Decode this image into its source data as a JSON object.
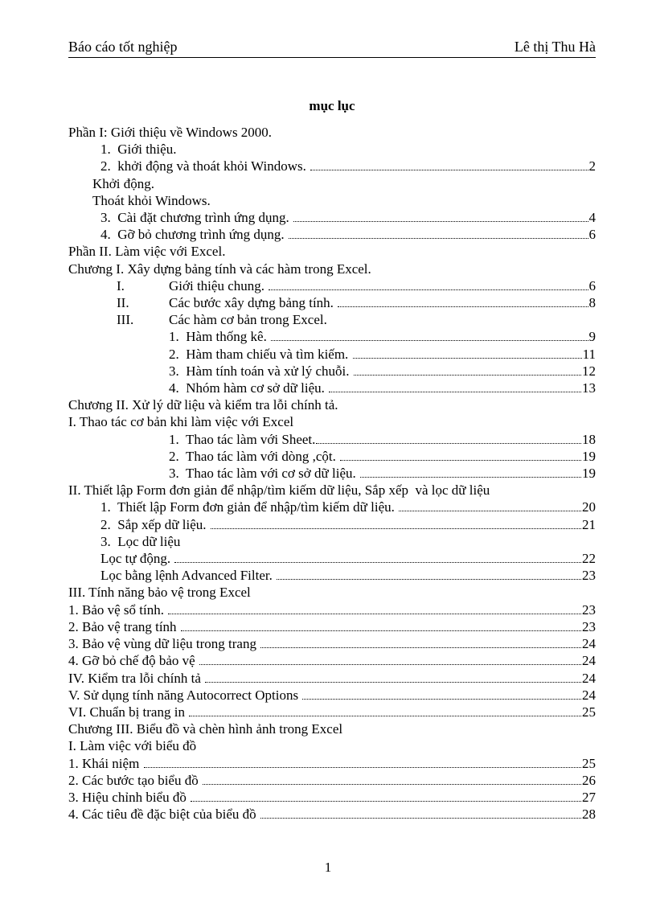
{
  "header": {
    "left": "Báo cáo tốt nghiệp",
    "right": "Lê thị Thu Hà"
  },
  "title": "mục lục",
  "footer_page": "1",
  "lines": [
    {
      "indent": "indent-0",
      "text": "Phần I: Giới thiệu về Windows 2000."
    },
    {
      "indent": "indent-1b",
      "text": "1.  Giới thiệu."
    },
    {
      "indent": "indent-1b",
      "text": "2.  khởi động và thoát khỏi Windows. ",
      "page": "2"
    },
    {
      "indent": "indent-1",
      "text": "Khởi động."
    },
    {
      "indent": "indent-1",
      "text": "Thoát khỏi Windows."
    },
    {
      "indent": "indent-1b",
      "text": "3.  Cài đặt chương trình ứng dụng. ",
      "page": "4"
    },
    {
      "indent": "indent-1b",
      "text": "4.  Gỡ bỏ chương trình ứng dụng. ",
      "page": "6"
    },
    {
      "indent": "indent-0",
      "text": "Phần II. Làm việc với Excel."
    },
    {
      "indent": "indent-0",
      "text": "Chương I. Xây dựng bảng tính và các hàm trong Excel."
    },
    {
      "indent": "indent-r",
      "roman": "I.",
      "text": "Giới thiệu chung. ",
      "page": "6"
    },
    {
      "indent": "indent-r",
      "roman": "II.",
      "text": "Các bước xây dựng bảng tính. ",
      "page": "8"
    },
    {
      "indent": "indent-r",
      "roman": "III.",
      "text": "Các hàm cơ bản trong Excel."
    },
    {
      "indent": "indent-sub3",
      "text": "1.  Hàm thống kê. ",
      "page": "9"
    },
    {
      "indent": "indent-sub3",
      "text": "2.  Hàm tham chiếu và tìm kiếm. ",
      "page": "11"
    },
    {
      "indent": "indent-sub3",
      "text": "3.  Hàm tính toán và xử lý chuỗi. ",
      "page": "12"
    },
    {
      "indent": "indent-sub3",
      "text": "4.  Nhóm hàm cơ sở dữ liệu. ",
      "page": "13"
    },
    {
      "indent": "indent-0",
      "text": "Chương II. Xử lý dữ liệu và kiểm tra lỗi chính tả."
    },
    {
      "indent": "indent-0",
      "text": "I. Thao tác cơ bản khi làm việc với Excel"
    },
    {
      "indent": "indent-sub3",
      "text": "1.  Thao tác làm với Sheet.",
      "page": "18"
    },
    {
      "indent": "indent-sub3",
      "text": "2.  Thao tác làm với dòng ,cột. ",
      "page": "19"
    },
    {
      "indent": "indent-sub3",
      "text": "3.  Thao tác làm với cơ sở dữ liệu. ",
      "page": "19"
    },
    {
      "indent": "indent-0",
      "text": "II. Thiết lập Form đơn giản để nhập/tìm kiếm dữ liệu, Sắp xếp  và lọc dữ liệu"
    },
    {
      "indent": "indent-1b",
      "text": "1.  Thiết lập Form đơn giản để nhập/tìm kiếm dữ liệu. ",
      "page": "20"
    },
    {
      "indent": "indent-1b",
      "text": "2.  Sắp xếp dữ liệu. ",
      "page": "21"
    },
    {
      "indent": "indent-1b",
      "text": "3.  Lọc dữ liệu"
    },
    {
      "indent": "indent-1b",
      "text": "Lọc tự động. ",
      "page": "22"
    },
    {
      "indent": "indent-1b",
      "text": "Lọc bằng lệnh Advanced Filter. ",
      "page": "23"
    },
    {
      "indent": "indent-0",
      "text": "III. Tính năng bảo vệ trong Excel"
    },
    {
      "indent": "indent-0",
      "text": "1. Bảo vệ sổ tính. ",
      "page": "23"
    },
    {
      "indent": "indent-0",
      "text": "2. Bảo vệ trang tính ",
      "page": "23"
    },
    {
      "indent": "indent-0",
      "text": "3. Bảo vệ vùng dữ liệu trong trang ",
      "page": "24"
    },
    {
      "indent": "indent-0",
      "text": "4. Gỡ bỏ chế độ bảo vệ ",
      "page": "24"
    },
    {
      "indent": "indent-0",
      "text": "IV. Kiểm tra lỗi chính tả ",
      "page": "24"
    },
    {
      "indent": "indent-0",
      "text": "V. Sử dụng tính năng Autocorrect Options ",
      "page": "24"
    },
    {
      "indent": "indent-0",
      "text": "VI. Chuẩn bị trang in ",
      "page": "25"
    },
    {
      "indent": "indent-0",
      "text": "Chương III. Biểu đồ và chèn hình ảnh trong Excel"
    },
    {
      "indent": "indent-0",
      "text": "I. Làm việc với biểu đồ"
    },
    {
      "indent": "indent-0",
      "text": "1. Khái niệm ",
      "page": "25"
    },
    {
      "indent": "indent-0",
      "text": "2. Các bước tạo biểu đồ ",
      "page": "26"
    },
    {
      "indent": "indent-0",
      "text": "3. Hiệu chỉnh biểu đồ ",
      "page": "27"
    },
    {
      "indent": "indent-0",
      "text": "4. Các tiêu đề đặc biệt của biểu đồ ",
      "page": "28"
    }
  ]
}
